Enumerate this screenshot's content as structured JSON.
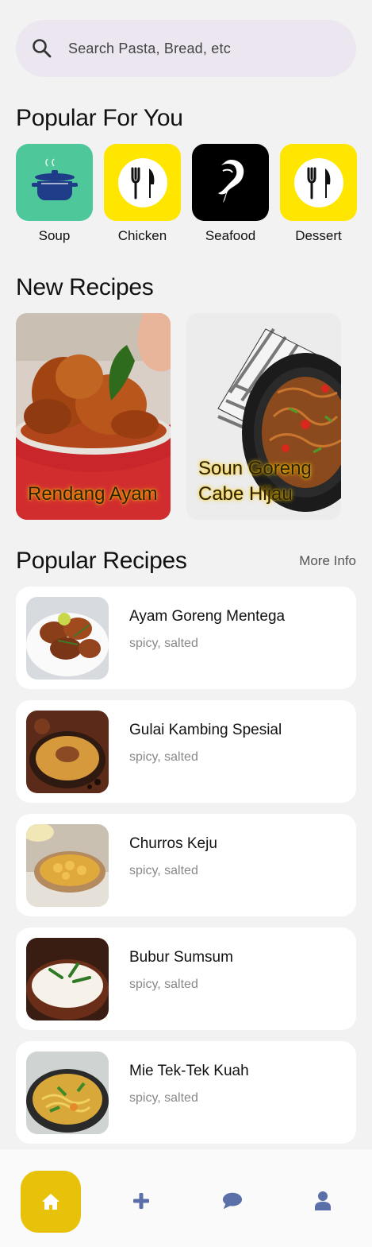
{
  "search": {
    "placeholder": "Search Pasta, Bread, etc",
    "icon": "search-icon"
  },
  "popular_for_you": {
    "title": "Popular For You",
    "categories": [
      {
        "label": "Soup",
        "icon": "pot-icon",
        "color": "#4ec79a"
      },
      {
        "label": "Chicken",
        "icon": "fork-knife-icon",
        "color": "#ffe600"
      },
      {
        "label": "Seafood",
        "icon": "fish-icon",
        "color": "#000000"
      },
      {
        "label": "Dessert",
        "icon": "fork-knife-icon",
        "color": "#ffe600"
      }
    ]
  },
  "new_recipes": {
    "title": "New Recipes",
    "items": [
      {
        "name": "Rendang Ayam"
      },
      {
        "name": "Soun Goreng Cabe Hijau"
      }
    ]
  },
  "popular_recipes": {
    "title": "Popular Recipes",
    "more_label": "More Info",
    "items": [
      {
        "title": "Ayam Goreng Mentega",
        "tags": "spicy, salted"
      },
      {
        "title": "Gulai Kambing Spesial",
        "tags": "spicy, salted"
      },
      {
        "title": "Churros Keju",
        "tags": "spicy, salted"
      },
      {
        "title": "Bubur Sumsum",
        "tags": "spicy, salted"
      },
      {
        "title": "Mie Tek-Tek Kuah",
        "tags": "spicy, salted"
      }
    ]
  },
  "nav": {
    "items": [
      "home-icon",
      "plus-icon",
      "chat-icon",
      "user-icon"
    ],
    "active": "home-icon",
    "active_color": "#e8c20a",
    "icon_color": "#5b6fa8"
  }
}
